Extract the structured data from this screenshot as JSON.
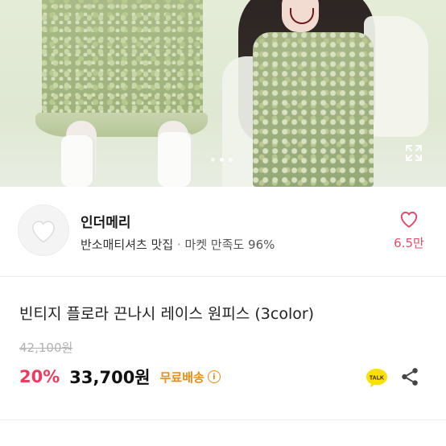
{
  "hero": {
    "carousel": {
      "count": 3,
      "active": 1
    },
    "icons": {
      "expand": "expand-icon"
    }
  },
  "seller": {
    "name": "인더메리",
    "tagline": "반소매티셔츠 맛집",
    "separator": "·",
    "rating": "마켓 만족도 96%",
    "avatar_icon": "heart-placeholder-icon",
    "likes": "6.5만",
    "like_icon": "heart-outline-icon"
  },
  "product": {
    "title": "빈티지 플로라 끈나시 레이스 원피스 (3color)",
    "original_price": "42,100원",
    "discount": "20%",
    "price": "33,700원",
    "shipping": "무료배송",
    "shipping_info_icon": "info-icon",
    "talk_label": "TALK",
    "talk_icon": "kakaotalk-icon",
    "share_icon": "share-icon"
  },
  "colors": {
    "discount": "#ef3a5d",
    "shipping": "#f08a10",
    "like": "#e24c6b",
    "talk_bg": "#fae100"
  }
}
